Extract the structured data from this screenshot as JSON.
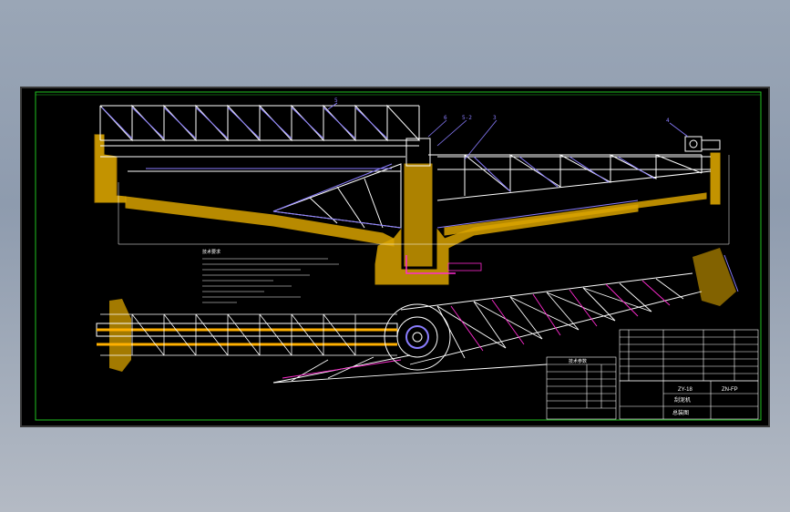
{
  "drawing": {
    "balloons": [
      "5",
      "6",
      "5-2",
      "3",
      "4"
    ],
    "title_block": {
      "company": "ZY-18",
      "drawing_name": "刮泥机",
      "sheet_label": "总装图",
      "drawing_no": "ZN-FP"
    },
    "tech_table_title": "技术参数",
    "notes_title": "技术要求"
  },
  "colors": {
    "background": "#000000",
    "lines": "#ffffff",
    "concrete": "#d9a300",
    "purple": "#8a7dff",
    "orange": "#ffb000",
    "border": "#20c020"
  },
  "icons": [
    "drawing-frame",
    "truss-bridge",
    "concrete-tank",
    "plan-view-truss",
    "drive-unit"
  ]
}
